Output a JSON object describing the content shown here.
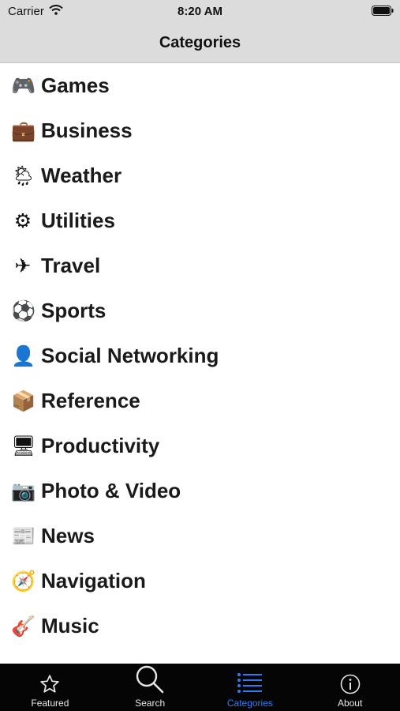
{
  "status_bar": {
    "carrier": "Carrier",
    "time": "8:20 AM"
  },
  "nav": {
    "title": "Categories"
  },
  "categories": [
    {
      "label": "Games",
      "icon": "🎮"
    },
    {
      "label": "Business",
      "icon": "💼"
    },
    {
      "label": "Weather",
      "icon": "🌦"
    },
    {
      "label": "Utilities",
      "icon": "⚙"
    },
    {
      "label": "Travel",
      "icon": "✈"
    },
    {
      "label": "Sports",
      "icon": "⚽"
    },
    {
      "label": "Social Networking",
      "icon": "👤"
    },
    {
      "label": "Reference",
      "icon": "📦"
    },
    {
      "label": "Productivity",
      "icon": "🖥"
    },
    {
      "label": "Photo & Video",
      "icon": "📷"
    },
    {
      "label": "News",
      "icon": "📰"
    },
    {
      "label": "Navigation",
      "icon": "🧭"
    },
    {
      "label": "Music",
      "icon": "🎸"
    }
  ],
  "tabs": [
    {
      "label": "Featured",
      "icon": "star-icon"
    },
    {
      "label": "Search",
      "icon": "magnifier-icon"
    },
    {
      "label": "Categories",
      "icon": "list-icon",
      "active": true
    },
    {
      "label": "About",
      "icon": "info-icon"
    }
  ],
  "colors": {
    "accent": "#2f7bf5",
    "tab_bar": "#050505",
    "nav_bar": "#dcdcdc"
  }
}
